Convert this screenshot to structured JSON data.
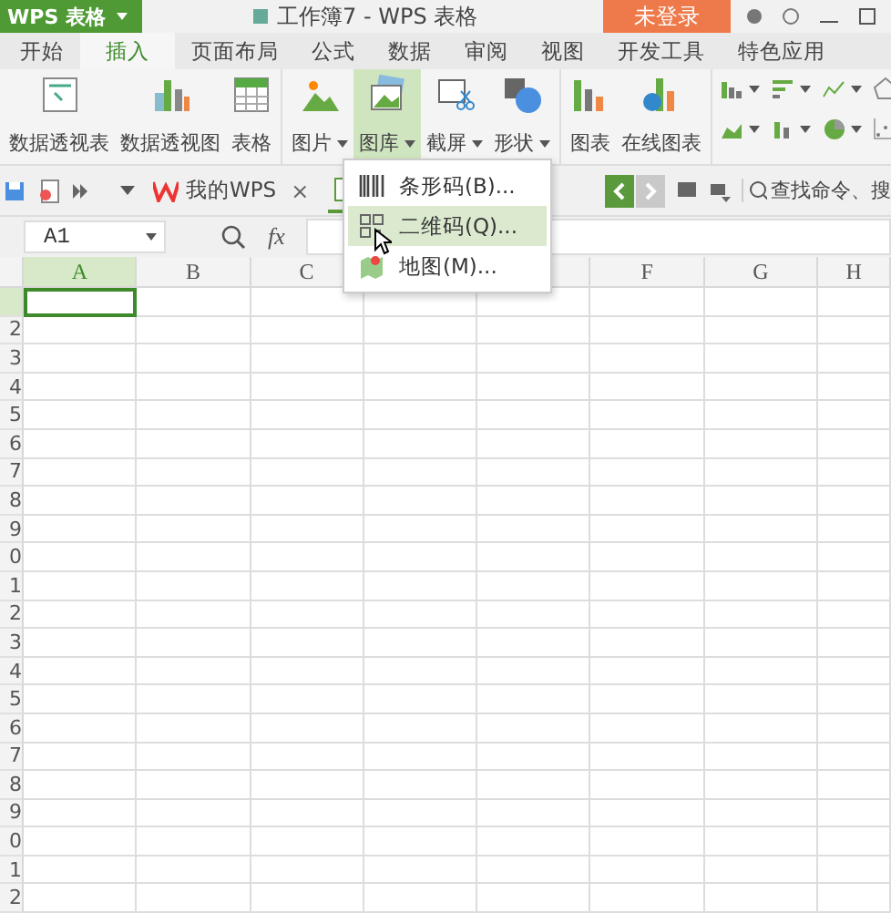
{
  "app_button": {
    "label": "WPS 表格"
  },
  "title": "工作簿7 - WPS 表格",
  "login_button": {
    "label": "未登录"
  },
  "tabs": [
    {
      "label": "开始",
      "selected": false
    },
    {
      "label": "插入",
      "selected": true
    },
    {
      "label": "页面布局",
      "selected": false
    },
    {
      "label": "公式",
      "selected": false
    },
    {
      "label": "数据",
      "selected": false
    },
    {
      "label": "审阅",
      "selected": false
    },
    {
      "label": "视图",
      "selected": false
    },
    {
      "label": "开发工具",
      "selected": false
    },
    {
      "label": "特色应用",
      "selected": false
    }
  ],
  "ribbon": {
    "groups": [
      [
        {
          "label": "数据透视表",
          "kind": "pivot",
          "dropdown": false,
          "selected": false
        },
        {
          "label": "数据透视图",
          "kind": "pivotchart",
          "dropdown": false,
          "selected": false
        },
        {
          "label": "表格",
          "kind": "table",
          "dropdown": false,
          "selected": false
        }
      ],
      [
        {
          "label": "图片",
          "kind": "picture",
          "dropdown": true,
          "selected": false
        },
        {
          "label": "图库",
          "kind": "gallery",
          "dropdown": true,
          "selected": true
        },
        {
          "label": "截屏",
          "kind": "screenshot",
          "dropdown": true,
          "selected": false
        },
        {
          "label": "形状",
          "kind": "shapes",
          "dropdown": true,
          "selected": false
        }
      ],
      [
        {
          "label": "图表",
          "kind": "chart",
          "dropdown": false,
          "selected": false
        },
        {
          "label": "在线图表",
          "kind": "onlinechart",
          "dropdown": false,
          "selected": false
        }
      ]
    ]
  },
  "quick_toolbar": {
    "doc_tab": {
      "label": "我的WPS",
      "close": "×"
    },
    "search": {
      "placeholder": "查找命令、搜"
    }
  },
  "formula_bar": {
    "name_box": "A1",
    "fx": "fx"
  },
  "sheet": {
    "columns": [
      {
        "label": "A",
        "selected": true
      },
      {
        "label": "B",
        "selected": false
      },
      {
        "label": "C",
        "selected": false
      },
      {},
      {},
      {
        "label": "F",
        "selected": false
      },
      {
        "label": "G",
        "selected": false
      },
      {
        "label": "H",
        "selected": false
      }
    ],
    "rows": [
      {
        "selected": true
      },
      {
        "label": "2",
        "selected": false
      },
      {
        "label": "3",
        "selected": false
      },
      {
        "label": "4",
        "selected": false
      },
      {
        "label": "5",
        "selected": false
      },
      {
        "label": "6",
        "selected": false
      },
      {
        "label": "7",
        "selected": false
      },
      {
        "label": "8",
        "selected": false
      },
      {
        "label": "9",
        "selected": false
      },
      {
        "label": "0",
        "selected": false
      },
      {
        "label": "1",
        "selected": false
      },
      {
        "label": "2",
        "selected": false
      },
      {
        "label": "3",
        "selected": false
      },
      {
        "label": "4",
        "selected": false
      },
      {
        "label": "5",
        "selected": false
      },
      {
        "label": "6",
        "selected": false
      },
      {
        "label": "7",
        "selected": false
      },
      {
        "label": "8",
        "selected": false
      },
      {
        "label": "9",
        "selected": false
      },
      {
        "label": "0",
        "selected": false
      },
      {
        "label": "1",
        "selected": false
      },
      {
        "label": "2",
        "selected": false
      }
    ]
  },
  "gallery_menu": {
    "items": [
      {
        "label": "条形码(B)...",
        "kind": "barcode",
        "hovered": false
      },
      {
        "label": "二维码(Q)...",
        "kind": "qrcode",
        "hovered": true
      },
      {
        "label": "地图(M)...",
        "kind": "map",
        "hovered": false
      }
    ]
  }
}
